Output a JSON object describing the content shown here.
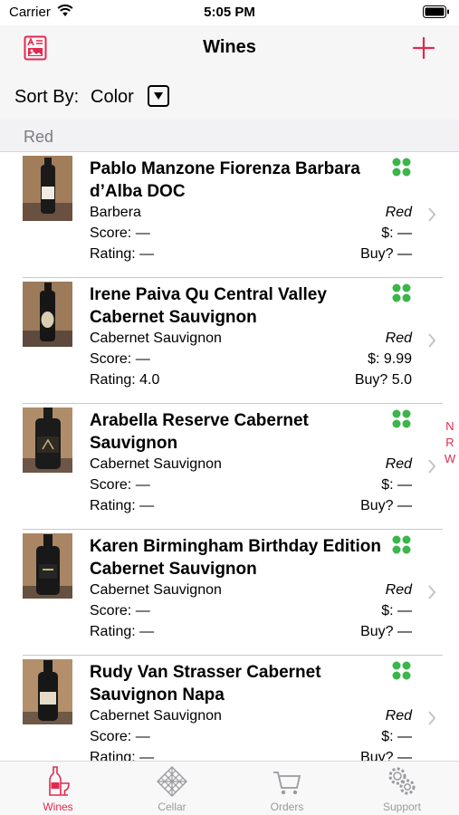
{
  "status": {
    "carrier": "Carrier",
    "time": "5:05 PM"
  },
  "nav": {
    "title": "Wines"
  },
  "sort": {
    "label": "Sort By:",
    "value": "Color"
  },
  "section": {
    "title": "Red"
  },
  "colors": {
    "accent": "#e2294f",
    "dots": "#3cb54a"
  },
  "wines": [
    {
      "name": "Pablo Manzone Fiorenza Barbara d’Alba DOC",
      "varietal": "Barbera",
      "color": "Red",
      "score": "Score:  —",
      "price": "$: —",
      "rating": "Rating:  —",
      "buy": "Buy? —"
    },
    {
      "name": "Irene Paiva Qu Central Valley Cabernet Sauvignon",
      "varietal": "Cabernet Sauvignon",
      "color": "Red",
      "score": "Score:  —",
      "price": "$: 9.99",
      "rating": "Rating:  4.0",
      "buy": "Buy? 5.0"
    },
    {
      "name": "Arabella Reserve Cabernet Sauvignon",
      "varietal": "Cabernet Sauvignon",
      "color": "Red",
      "score": "Score:  —",
      "price": "$: —",
      "rating": "Rating:  —",
      "buy": "Buy? —"
    },
    {
      "name": "Karen Birmingham Birthday Edition Cabernet Sauvignon",
      "varietal": "Cabernet Sauvignon",
      "color": "Red",
      "score": "Score:  —",
      "price": "$: —",
      "rating": "Rating:  —",
      "buy": "Buy? —"
    },
    {
      "name": "Rudy Van Strasser Cabernet Sauvignon Napa",
      "varietal": "Cabernet Sauvignon",
      "color": "Red",
      "score": "Score:  —",
      "price": "$: —",
      "rating": "Rating:  —",
      "buy": "Buy? —"
    }
  ],
  "index": [
    "N",
    "R",
    "W"
  ],
  "tabs": [
    {
      "label": "Wines",
      "icon": "wine-bottle-glass-icon",
      "active": true
    },
    {
      "label": "Cellar",
      "icon": "cellar-rack-icon",
      "active": false
    },
    {
      "label": "Orders",
      "icon": "cart-icon",
      "active": false
    },
    {
      "label": "Support",
      "icon": "gears-icon",
      "active": false
    }
  ]
}
